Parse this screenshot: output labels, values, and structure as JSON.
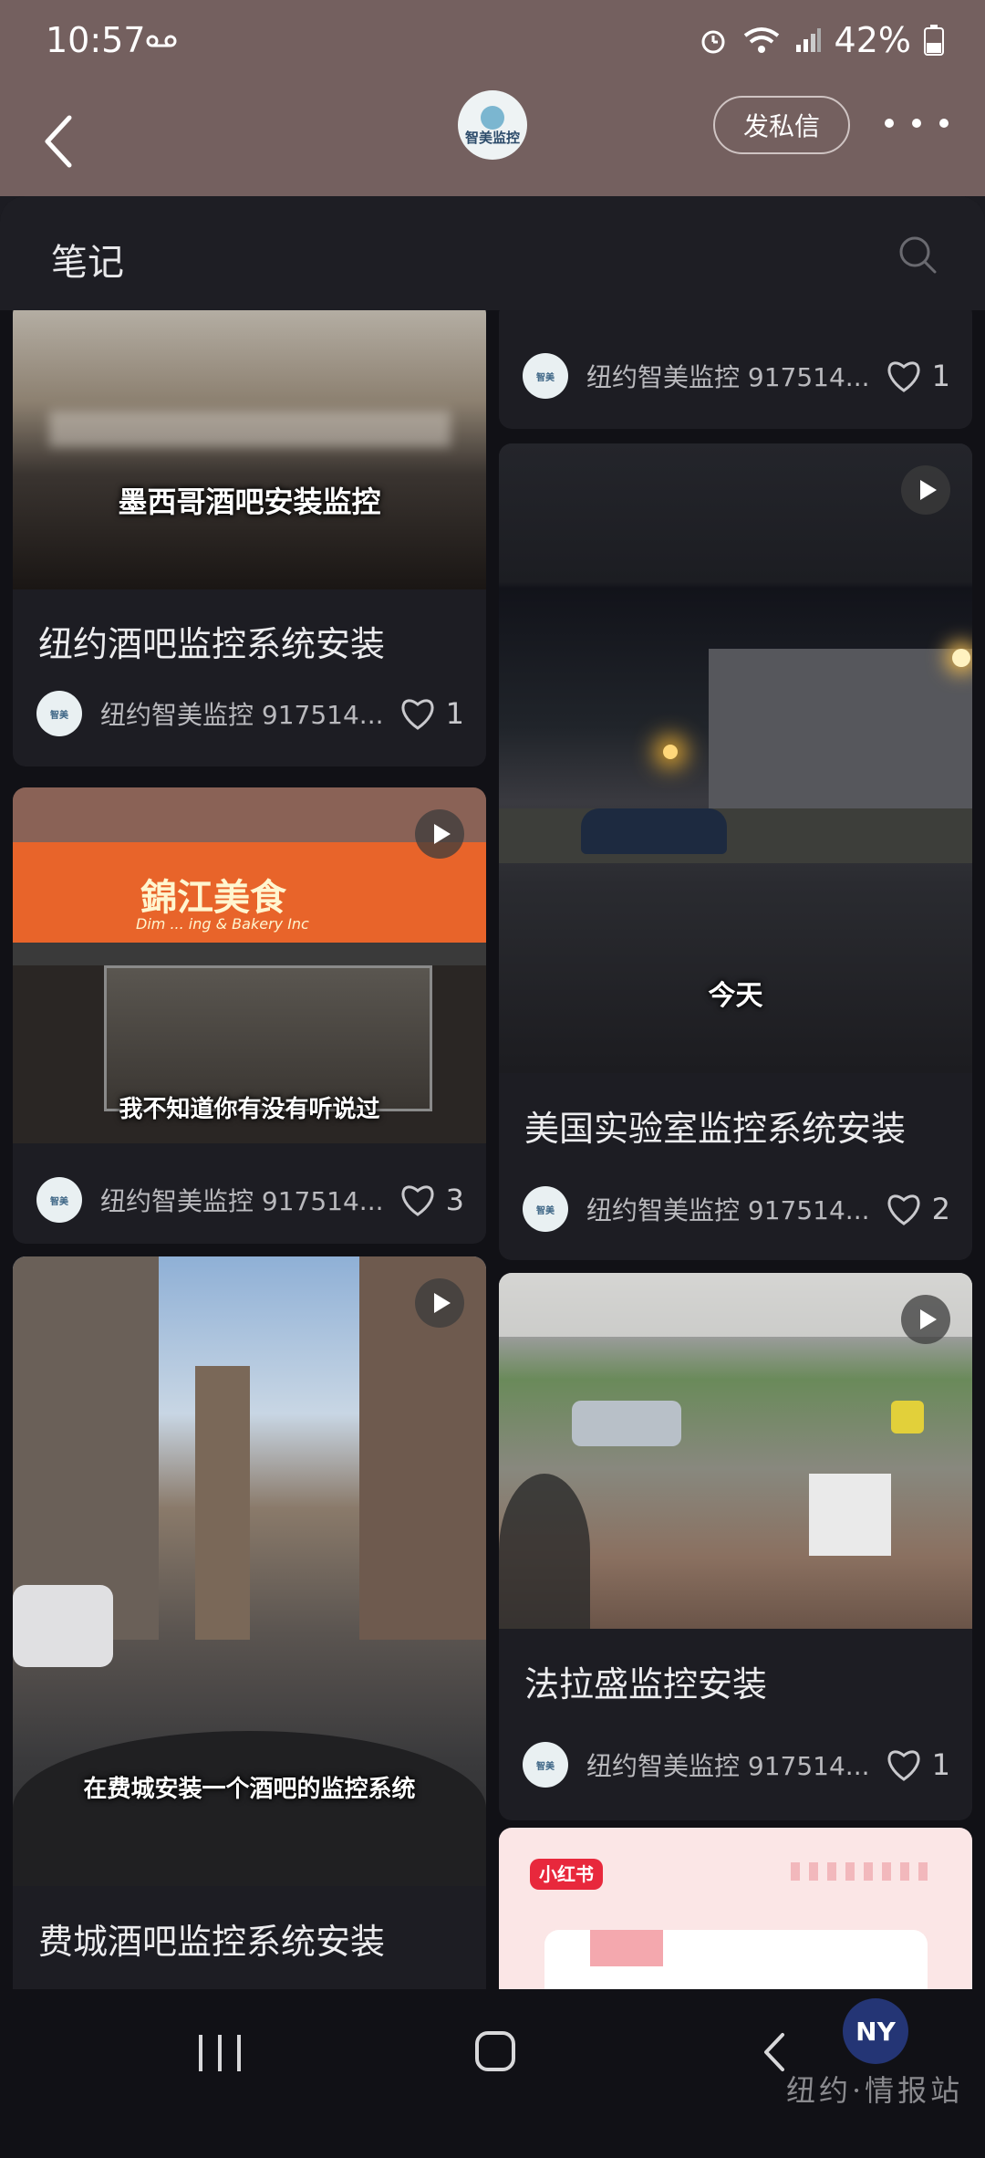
{
  "status": {
    "time": "10:57",
    "battery": "42%"
  },
  "header": {
    "logo_text": "智美监控",
    "dm_label": "发私信"
  },
  "section": {
    "title": "笔记"
  },
  "cards": [
    {
      "title": "",
      "author": "纽约智美监控 917514...",
      "likes": "1"
    },
    {
      "title": "纽约酒吧监控系统安装",
      "overlay": "墨西哥酒吧安装监控",
      "author": "纽约智美监控 917514...",
      "likes": "1"
    },
    {
      "title": "美国实验室监控系统安装",
      "overlay": "今天",
      "author": "纽约智美监控 917514...",
      "likes": "2"
    },
    {
      "title": "",
      "overlay": "我不知道你有没有听说过",
      "sign": "錦江美食",
      "sign_sub": "Dim ... ing & Bakery Inc",
      "author": "纽约智美监控 917514...",
      "likes": "3"
    },
    {
      "title": "法拉盛监控安装",
      "author": "纽约智美监控 917514...",
      "likes": "1"
    },
    {
      "title": "费城酒吧监控系统安装",
      "overlay": "在费城安装一个酒吧的监控系统"
    },
    {
      "badge": "小红书"
    }
  ],
  "watermark": {
    "logo": "NY",
    "text": "纽约·情报站"
  },
  "colors": {
    "header_bg": "#74605f",
    "panel_bg": "#111116",
    "card_bg": "#1d1d23",
    "badge": "#e8283c"
  }
}
